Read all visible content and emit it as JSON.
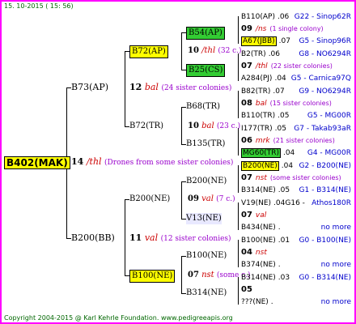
{
  "header": {
    "date": "15. 10-2015 ( 15: 56)"
  },
  "footer": {
    "copyright": "Copyright 2004-2015 @ Karl Kehrle Foundation.",
    "url": "www.pedigreeapis.org"
  },
  "root": {
    "name": "B402(MAK)",
    "num": "14",
    "code": "/thl",
    "desc": "(Drones from some sister colonies)"
  },
  "level1": [
    {
      "name": "B73(AP)",
      "num": "12",
      "code": "bal",
      "desc": "(24 sister colonies)"
    },
    {
      "name": "B200(BB)",
      "num": "11",
      "code": "val",
      "desc": "(12 sister colonies)"
    }
  ],
  "level2": [
    {
      "name": "B72(AP)",
      "num": "10",
      "code": "/thl",
      "desc": "(32 c.)"
    },
    {
      "name": "B72(TR)",
      "num": "10",
      "code": "bal",
      "desc": "(23 c.)"
    },
    {
      "name": "B200(NE)",
      "num": "09",
      "code": "val",
      "desc": "(7 c.)"
    },
    {
      "name": "B100(NE)",
      "num": "07",
      "code": "nst",
      "desc": "(some c.)"
    }
  ],
  "level3": [
    {
      "name": "B54(AP)"
    },
    {
      "name": "B25(CS)"
    },
    {
      "name": "B68(TR)"
    },
    {
      "name": "B135(TR)"
    },
    {
      "name": "B200(NE)"
    },
    {
      "name": "V13(NE)"
    },
    {
      "name": "B100(NE)"
    },
    {
      "name": "B314(NE)"
    }
  ],
  "level4": [
    {
      "top": {
        "name": "B110(AP)",
        "num": ".06",
        "right": "G22 - Sinop62R"
      },
      "mid": {
        "num": "09",
        "code": "/ns",
        "desc": "(1 single colony)"
      },
      "bot": {
        "name": "A67(JBB)",
        "num": ".07",
        "right": "G5 - Sinop96R"
      }
    },
    {
      "top": {
        "name": "B2(TR)",
        "num": ".06",
        "right": "G8 - NO6294R"
      },
      "mid": {
        "num": "07",
        "code": "/thl",
        "desc": "(22 sister colonies)"
      },
      "bot": {
        "name": "A284(PJ)",
        "num": ".04",
        "right": "G5 - Carnica97Q"
      }
    },
    {
      "top": {
        "name": "B82(TR)",
        "num": ".07",
        "right": "G9 - NO6294R"
      },
      "mid": {
        "num": "08",
        "code": "bal",
        "desc": "(15 sister colonies)"
      },
      "bot": {
        "name": "B110(TR)",
        "num": ".05",
        "right": "G5 - MG00R"
      }
    },
    {
      "top": {
        "name": "I177(TR)",
        "num": ".05",
        "right": "G7 - Takab93aR"
      },
      "mid": {
        "num": "06",
        "code": "mrk",
        "desc": "(21 sister colonies)"
      },
      "bot": {
        "name": "MG60(TR)",
        "num": ".04",
        "right": "G4 - MG00R"
      }
    },
    {
      "top": {
        "name": "B200(NE)",
        "num": ".04",
        "right": "G2 - B200(NE)"
      },
      "mid": {
        "num": "07",
        "code": "nst",
        "desc": "(some sister colonies)"
      },
      "bot": {
        "name": "B314(NE)",
        "num": ".05",
        "right": "G1 - B314(NE)"
      }
    },
    {
      "top": {
        "name": "V19(NE)",
        "num": ".04G16 -",
        "right": "Athos180R"
      },
      "mid": {
        "num": "07",
        "code": "val",
        "desc": ""
      },
      "bot": {
        "name": "B434(NE)",
        "num": ".",
        "right": "no more"
      }
    },
    {
      "top": {
        "name": "B100(NE)",
        "num": ".01",
        "right": "G0 - B100(NE)"
      },
      "mid": {
        "num": "04",
        "code": "nst",
        "desc": ""
      },
      "bot": {
        "name": "B374(NE)",
        "num": ".",
        "right": "no more"
      }
    },
    {
      "top": {
        "name": "B314(NE)",
        "num": ".03",
        "right": "G0 - B314(NE)"
      },
      "mid": {
        "num": "05",
        "code": "",
        "desc": ""
      },
      "bot": {
        "name": "???(NE)",
        "num": ".",
        "right": "no more"
      }
    }
  ],
  "colors": {
    "border": "#ff00ff",
    "yellow": "#ffff00",
    "green": "#33cc33",
    "purple": "#9900cc",
    "blue": "#0000cc",
    "red": "#cc0000"
  }
}
